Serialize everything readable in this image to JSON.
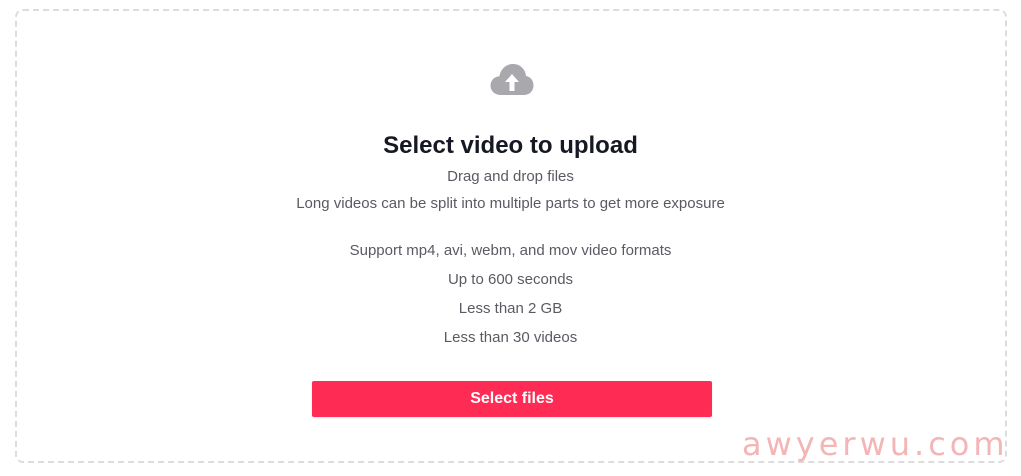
{
  "upload": {
    "icon": "cloud-upload-icon",
    "title": "Select video to upload",
    "subtitle": "Drag and drop files",
    "split_note": "Long videos can be split into multiple parts to get more exposure",
    "requirements": [
      "Support mp4, avi, webm, and mov video formats",
      "Up to 600 seconds",
      "Less than 2 GB",
      "Less than 30 videos"
    ],
    "button_label": "Select files"
  },
  "watermark": {
    "text": "awyerwu.com"
  },
  "colors": {
    "accent": "#fe2c55",
    "icon": "#a8a8ad",
    "title": "#161823",
    "body_text": "#5a5a62",
    "border": "#dcdcdc"
  }
}
